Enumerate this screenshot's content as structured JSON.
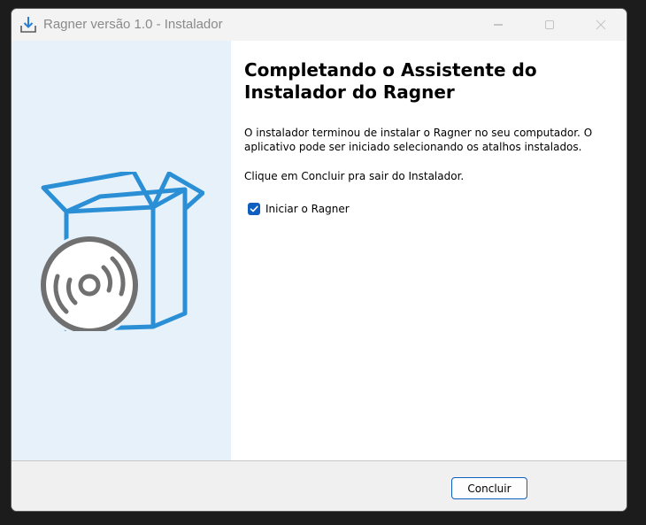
{
  "window": {
    "title": "Ragner versão 1.0 - Instalador",
    "icon": "download-installer-icon"
  },
  "titlebar_buttons": {
    "minimize": "minimize-icon",
    "maximize": "maximize-icon",
    "close": "close-icon"
  },
  "sidebar": {
    "illustration": "box-with-disc-icon"
  },
  "content": {
    "heading": "Completando o Assistente do Instalador do Ragner",
    "paragraph1": "O instalador terminou de instalar o Ragner no seu computador. O aplicativo pode ser iniciado selecionando os atalhos instalados.",
    "paragraph2": "Clique em Concluir pra sair do Instalador.",
    "launch_checkbox": {
      "label": "Iniciar o Ragner",
      "checked": true
    }
  },
  "footer": {
    "finish_label": "Concluir"
  },
  "colors": {
    "accent": "#0f5fc0",
    "sidebar_bg": "#e7f1f9",
    "box_blue": "#2b8fd6",
    "disc_gray": "#707070"
  }
}
